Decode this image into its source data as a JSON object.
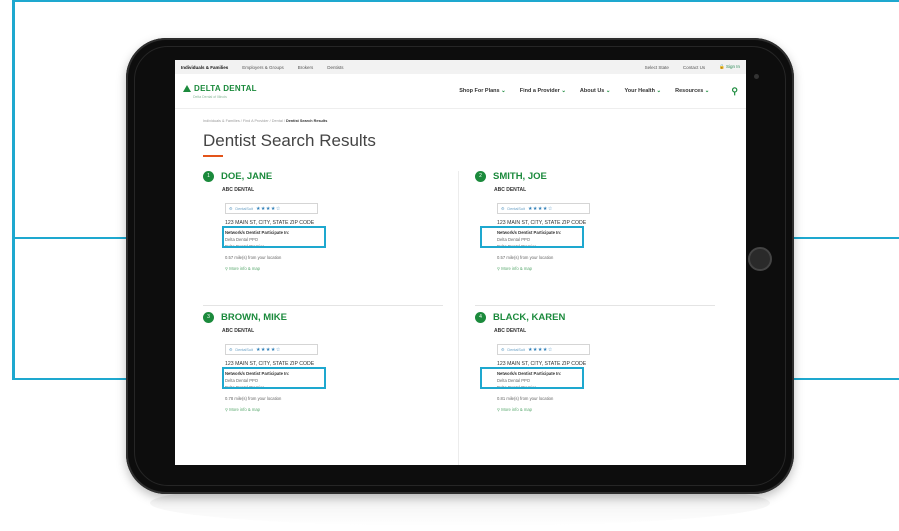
{
  "topbar": {
    "tabs": [
      "Individuals & Families",
      "Employers & Groups",
      "Brokers",
      "Dentists"
    ],
    "right": [
      "Select State",
      "Contact Us",
      "Sign In"
    ]
  },
  "header": {
    "logo": "DELTA DENTAL",
    "tagline": "Delta Dental of Illinois",
    "nav": [
      "Shop For Plans",
      "Find a Provider",
      "About Us",
      "Your Health",
      "Resources"
    ]
  },
  "breadcrumb": {
    "path": "Individuals & Families  /  Find A Provider  /  Dental  /",
    "current": "Dentist Search Results"
  },
  "page_title": "Dentist Search Results",
  "results": [
    {
      "num": "1",
      "name": "DOE, JANE",
      "practice": "ABC DENTAL",
      "rating_label": "DentalSuit",
      "stars": "★★★★☆",
      "address": "123 MAIN ST, CITY, STATE ZIP CODE",
      "network_label": "Network/s Dentist Participate In:",
      "plans": [
        "Delta Dental PPO",
        "Delta Dental Premier"
      ],
      "distance": "0.57 mile(s) from your location",
      "more": "More info & map"
    },
    {
      "num": "2",
      "name": "SMITH, JOE",
      "practice": "ABC DENTAL",
      "rating_label": "DentalSuit",
      "stars": "★★★★☆",
      "address": "123 MAIN ST, CITY, STATE ZIP CODE",
      "network_label": "Network/s Dentist Participate In:",
      "plans": [
        "Delta Dental PPO",
        "Delta Dental Premier"
      ],
      "distance": "0.57 mile(s) from your location",
      "more": "More info & map"
    },
    {
      "num": "3",
      "name": "BROWN, MIKE",
      "practice": "ABC DENTAL",
      "rating_label": "DentalSuit",
      "stars": "★★★★☆",
      "address": "123 MAIN ST, CITY, STATE ZIP CODE",
      "network_label": "Network/s Dentist Participate In:",
      "plans": [
        "Delta Dental PPO",
        "Delta Dental Premier"
      ],
      "distance": "0.78 mile(s) from your location",
      "more": "More info & map"
    },
    {
      "num": "4",
      "name": "BLACK, KAREN",
      "practice": "ABC DENTAL",
      "rating_label": "DentalSuit",
      "stars": "★★★★☆",
      "address": "123 MAIN ST, CITY, STATE ZIP CODE",
      "network_label": "Network/s Dentist Participate In:",
      "plans": [
        "Delta Dental PPO",
        "Delta Dental Premier"
      ],
      "distance": "0.81 mile(s) from your location",
      "more": "More info & map"
    }
  ],
  "colors": {
    "brand_green": "#1b8a3c",
    "callout_blue": "#1ea8cf",
    "accent_orange": "#e3541a"
  }
}
